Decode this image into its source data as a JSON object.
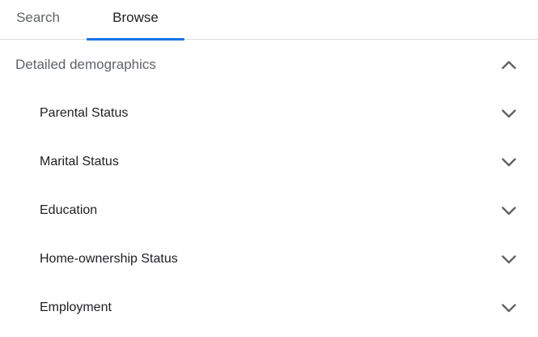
{
  "tabs": [
    {
      "label": "Search",
      "active": false
    },
    {
      "label": "Browse",
      "active": true
    }
  ],
  "colors": {
    "accent": "#1a73e8",
    "icon": "#5f6368",
    "divider": "#dadce0"
  },
  "section": {
    "title": "Detailed demographics",
    "icon": "chevron-up-icon",
    "expanded": true,
    "items": [
      {
        "label": "Parental Status",
        "icon": "chevron-down-icon"
      },
      {
        "label": "Marital Status",
        "icon": "chevron-down-icon"
      },
      {
        "label": "Education",
        "icon": "chevron-down-icon"
      },
      {
        "label": "Home-ownership Status",
        "icon": "chevron-down-icon"
      },
      {
        "label": "Employment",
        "icon": "chevron-down-icon"
      }
    ]
  }
}
